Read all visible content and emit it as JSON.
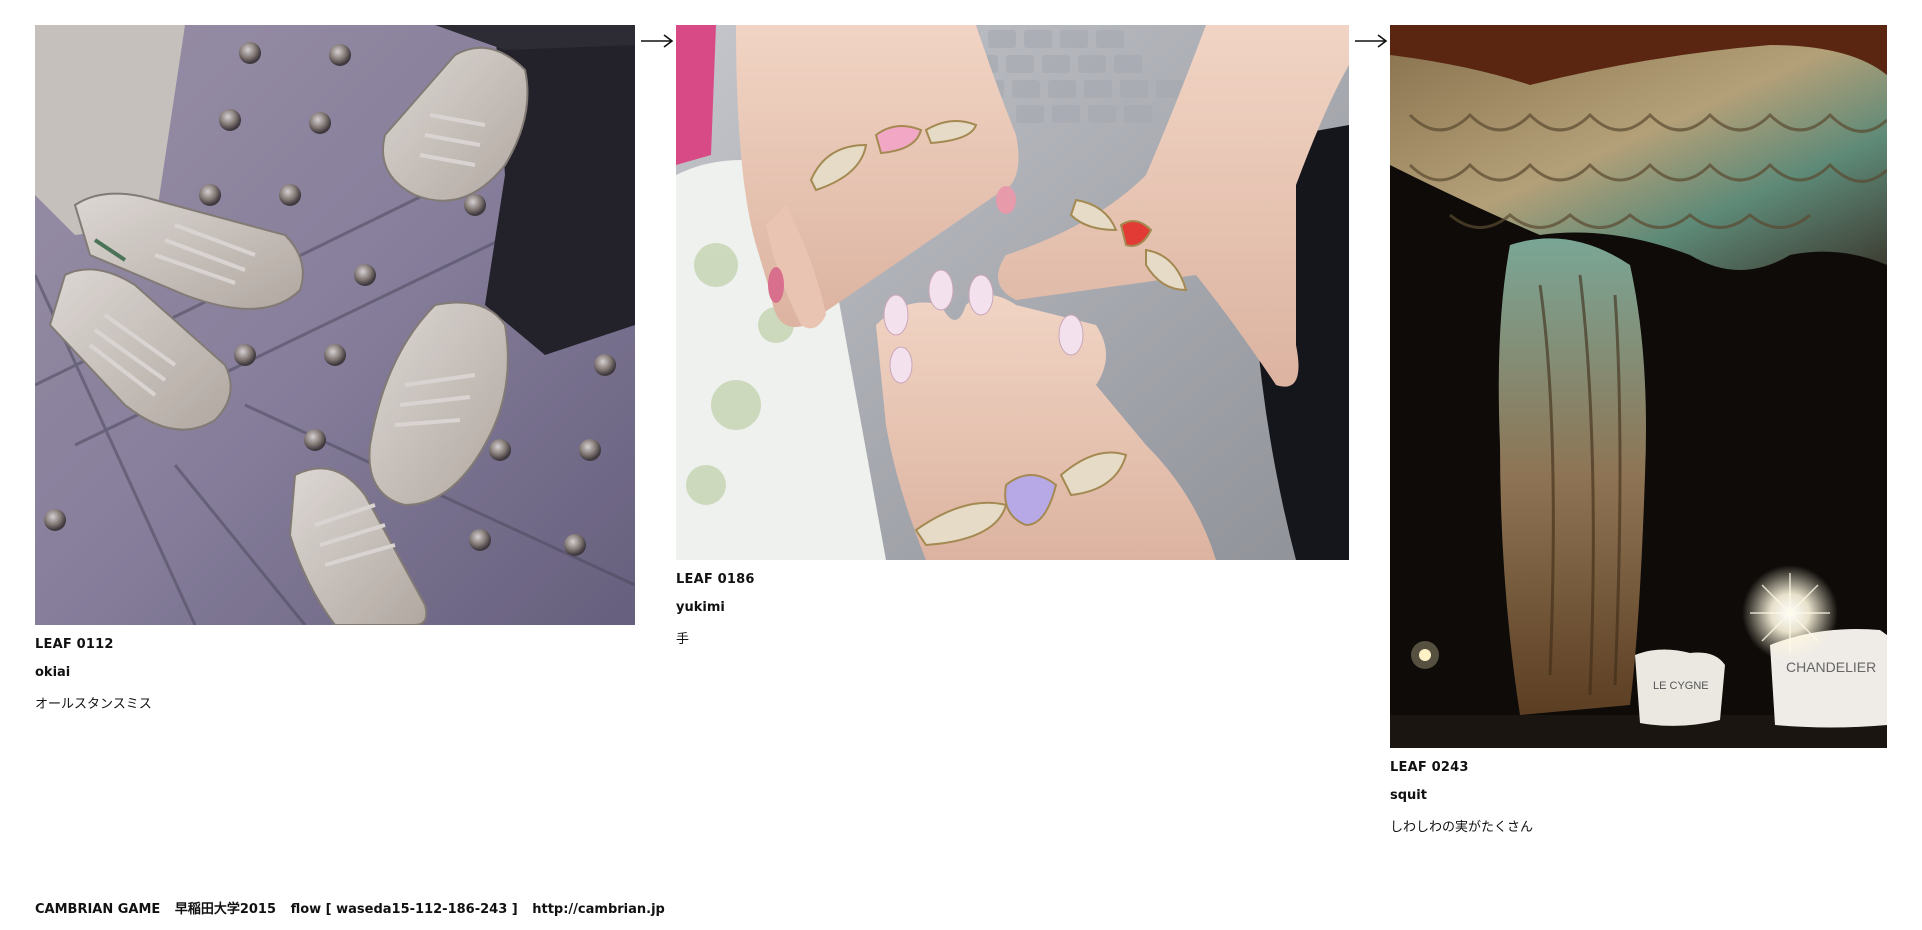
{
  "leaves": [
    {
      "id": "LEAF 0112",
      "author": "okiai",
      "title": "オールスタンスミス",
      "image": "photo of four feet in white sneakers on a studded pavement"
    },
    {
      "id": "LEAF 0186",
      "author": "yukimi",
      "title": "手",
      "image": "photo of three hands with jeweled wing and heart rings"
    },
    {
      "id": "LEAF 0243",
      "author": "squit",
      "title": "しわしわの実がたくさん",
      "image": "photo of a draped theatre curtain with stage lights"
    }
  ],
  "stage_signs": [
    "LE CYGNE",
    "CHANDELIER"
  ],
  "footer": {
    "game": "CAMBRIAN GAME",
    "event": "早稲田大学2015",
    "flow": "flow [ waseda15-112-186-243 ]",
    "url": "http://cambrian.jp"
  },
  "icons": [
    "flow-arrow-icon"
  ]
}
